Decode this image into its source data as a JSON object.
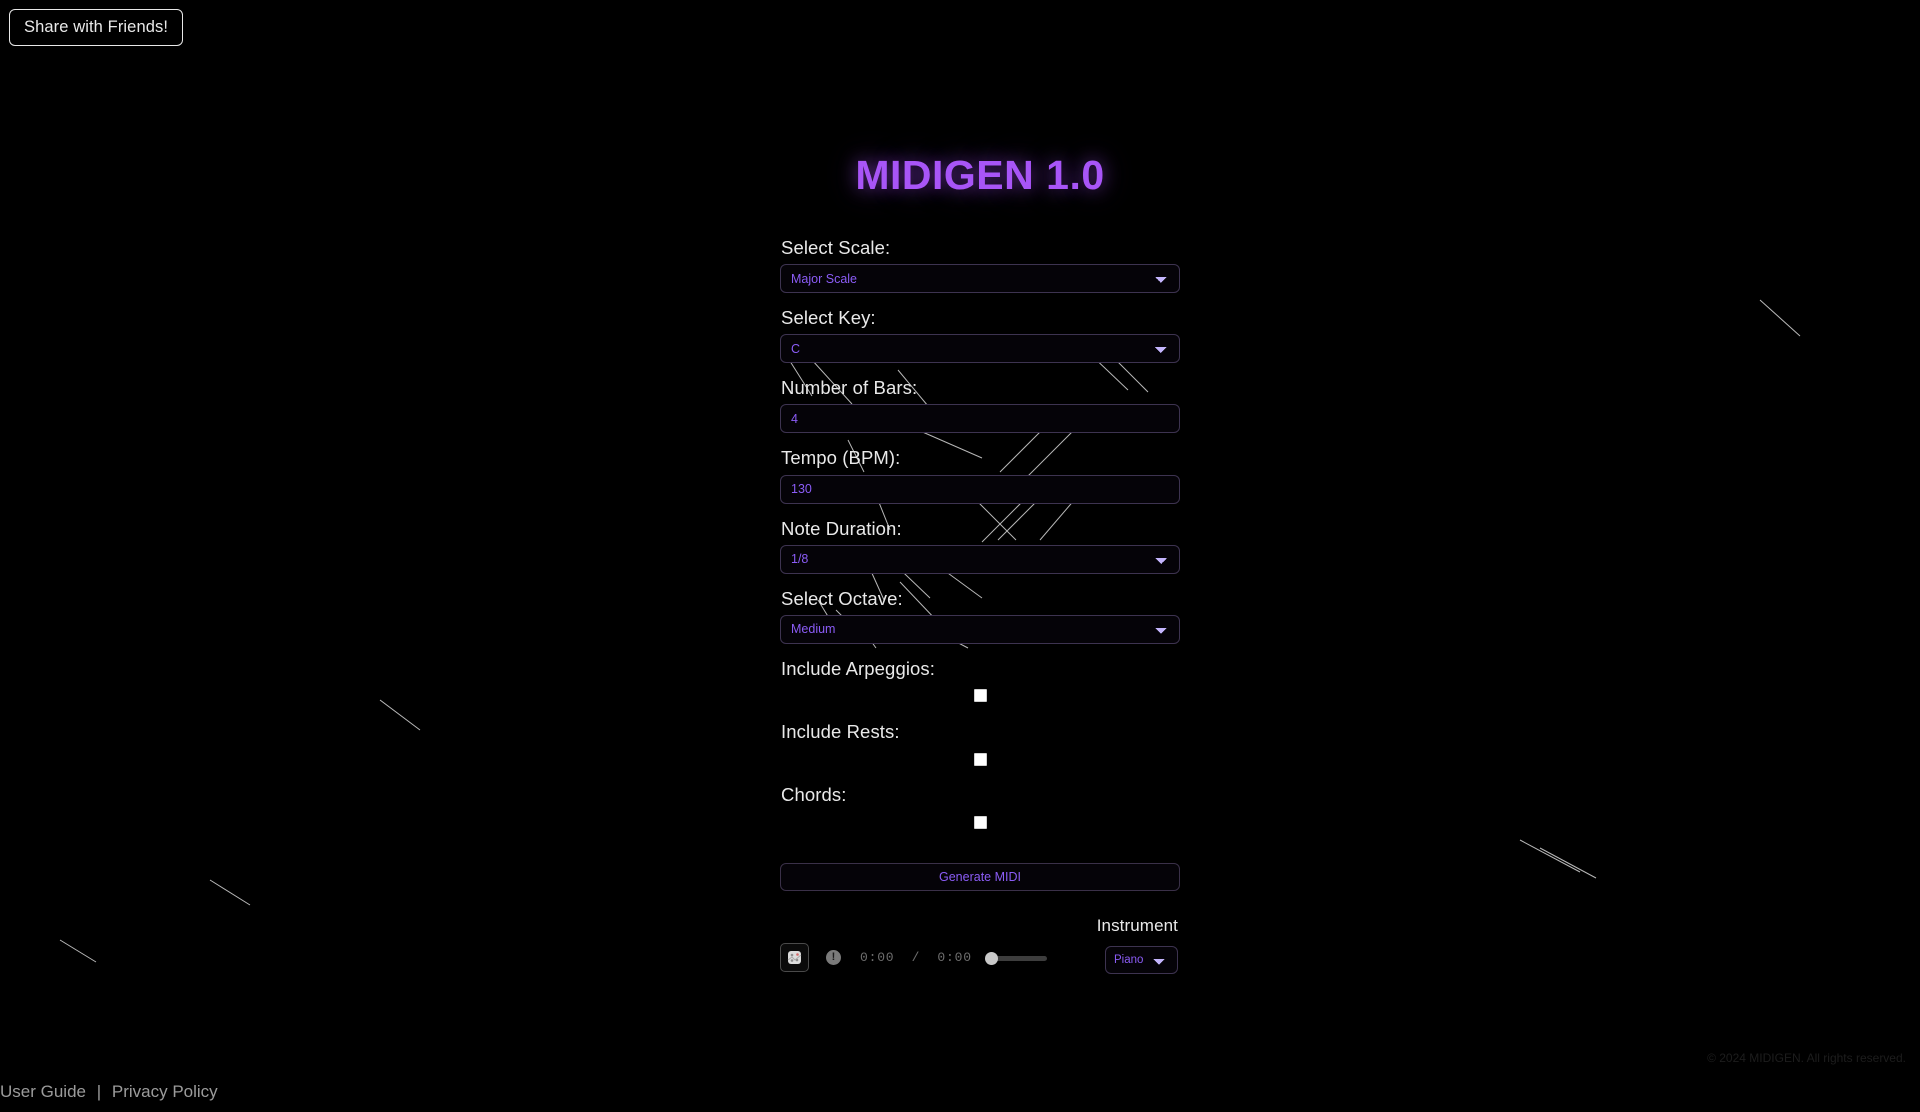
{
  "window": {
    "background_color": "#000000",
    "accent_color": "#a855f7",
    "control_text_color": "#8b5cf6"
  },
  "share": {
    "label": "Share with Friends!",
    "icon": "share-icon"
  },
  "header": {
    "title": "MIDIGEN 1.0"
  },
  "form": {
    "scale": {
      "label": "Select Scale:",
      "value": "Major Scale",
      "icon": "chevron-down-icon"
    },
    "key": {
      "label": "Select Key:",
      "value": "C",
      "icon": "chevron-down-icon"
    },
    "bars": {
      "label": "Number of Bars:",
      "value": "4"
    },
    "tempo": {
      "label": "Tempo (BPM):",
      "value": "130"
    },
    "note_duration": {
      "label": "Note Duration:",
      "value": "1/8",
      "icon": "chevron-down-icon"
    },
    "octave": {
      "label": "Select Octave:",
      "value": "Medium",
      "icon": "chevron-down-icon"
    },
    "arpeggios": {
      "label": "Include Arpeggios:",
      "checked": false
    },
    "rests": {
      "label": "Include Rests:",
      "checked": false
    },
    "chords": {
      "label": "Chords:",
      "checked": false
    },
    "generate": {
      "label": "Generate MIDI"
    }
  },
  "player": {
    "thumbnail_icon": "broken-image-icon",
    "error_icon": "error-exclamation-icon",
    "current_time": "0:00",
    "separator": "/",
    "duration": "0:00",
    "time_display": "0:00  /  0:00",
    "volume_icon": "volume-slider",
    "volume_value": 0
  },
  "instrument": {
    "label": "Instrument",
    "value": "Piano",
    "icon": "chevron-down-icon"
  },
  "footer": {
    "user_guide": "User Guide",
    "separator": "|",
    "privacy_policy": "Privacy Policy",
    "copyright": "© 2024 MIDIGEN. All rights reserved."
  }
}
